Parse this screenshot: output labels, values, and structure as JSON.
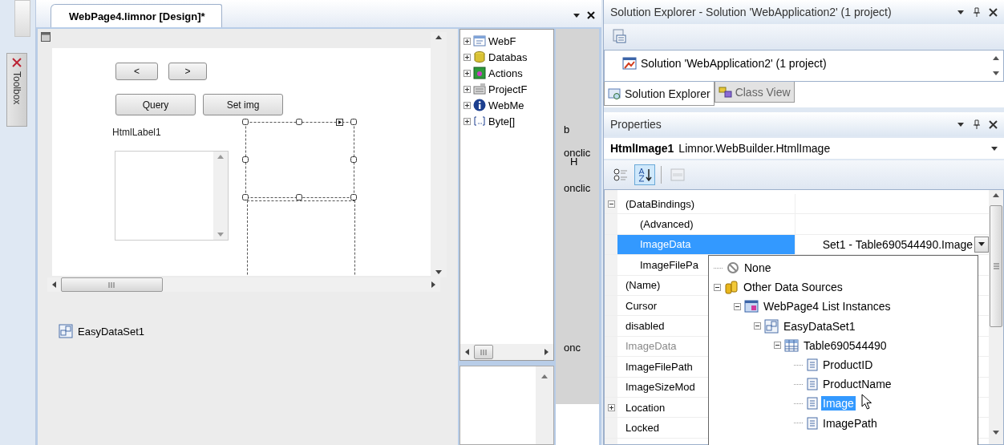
{
  "toolbox": {
    "label": "Toolbox"
  },
  "document": {
    "tab": {
      "title": "WebPage4.limnor [Design]*",
      "selected": true
    },
    "canvas": {
      "buttons": [
        {
          "label": "<",
          "kind": "small"
        },
        {
          "label": ">",
          "kind": "small"
        },
        {
          "label": "Query",
          "kind": "wide"
        },
        {
          "label": "Set img",
          "kind": "wide"
        }
      ],
      "label": "HtmlLabel1"
    },
    "component_tray": [
      {
        "label": "EasyDataSet1"
      }
    ],
    "toolbox_tree": [
      {
        "label": "WebF",
        "kind": "form",
        "expanded": false
      },
      {
        "label": "Databas",
        "kind": "database",
        "expanded": false
      },
      {
        "label": "Actions",
        "kind": "actions",
        "expanded": false
      },
      {
        "label": "ProjectF",
        "kind": "project",
        "expanded": false
      },
      {
        "label": "WebMe",
        "kind": "info",
        "expanded": false
      },
      {
        "label": "Byte[]",
        "kind": "array",
        "expanded": false
      }
    ],
    "side_strip_texts": [
      "b",
      "onclic",
      "H",
      "onclic",
      "onc"
    ]
  },
  "solution_explorer": {
    "title": "Solution Explorer - Solution 'WebApplication2' (1 project)",
    "tree": [
      {
        "label": "Solution 'WebApplication2' (1 project)"
      }
    ],
    "tabs": [
      {
        "label": "Solution Explorer",
        "selected": true
      },
      {
        "label": "Class View",
        "selected": false
      }
    ]
  },
  "properties": {
    "title": "Properties",
    "object_name": "HtmlImage1",
    "object_type": "Limnor.WebBuilder.HtmlImage",
    "toolbar": [
      {
        "kind": "categorized",
        "selected": false,
        "disabled": false
      },
      {
        "kind": "alphabetical",
        "selected": true,
        "disabled": false
      },
      {
        "kind": "pages",
        "selected": false,
        "disabled": true
      }
    ],
    "rows": [
      {
        "name": "(DataBindings)",
        "kind": "category",
        "expanded": true,
        "selected": false,
        "readonly": false,
        "children": [
          {
            "name": "(Advanced)",
            "kind": "property",
            "selected": false,
            "readonly": false
          },
          {
            "name": "ImageData",
            "kind": "property",
            "selected": true,
            "readonly": false,
            "value": "Set1 - Table690544490.Image"
          },
          {
            "name": "ImageFilePa",
            "kind": "property",
            "selected": false,
            "readonly": false
          }
        ]
      },
      {
        "name": "(Name)",
        "kind": "property",
        "selected": false,
        "readonly": false
      },
      {
        "name": "Cursor",
        "kind": "property",
        "selected": false,
        "readonly": false
      },
      {
        "name": "disabled",
        "kind": "property",
        "selected": false,
        "readonly": false
      },
      {
        "name": "ImageData",
        "kind": "property",
        "selected": false,
        "readonly": true
      },
      {
        "name": "ImageFilePath",
        "kind": "property",
        "selected": false,
        "readonly": false
      },
      {
        "name": "ImageSizeMod",
        "kind": "property",
        "selected": false,
        "readonly": false
      },
      {
        "name": "Location",
        "kind": "category",
        "expanded": false,
        "selected": false,
        "readonly": false
      },
      {
        "name": "Locked",
        "kind": "property",
        "selected": false,
        "readonly": false
      }
    ]
  },
  "dropdown": {
    "items": [
      {
        "label": "None",
        "kind": "none",
        "selected": false
      },
      {
        "label": "Other Data Sources",
        "kind": "folder",
        "selected": false,
        "expanded": true,
        "children": [
          {
            "label": "WebPage4 List Instances",
            "kind": "list",
            "selected": false,
            "expanded": true,
            "children": [
              {
                "label": "EasyDataSet1",
                "kind": "dataset",
                "selected": false,
                "expanded": true,
                "children": [
                  {
                    "label": "Table690544490",
                    "kind": "table",
                    "selected": false,
                    "expanded": true,
                    "children": [
                      {
                        "label": "ProductID",
                        "kind": "field",
                        "selected": false
                      },
                      {
                        "label": "ProductName",
                        "kind": "field",
                        "selected": false
                      },
                      {
                        "label": "Image",
                        "kind": "field",
                        "selected": true
                      },
                      {
                        "label": "ImagePath",
                        "kind": "field",
                        "selected": false
                      }
                    ]
                  }
                ]
              }
            ]
          }
        ]
      }
    ]
  }
}
